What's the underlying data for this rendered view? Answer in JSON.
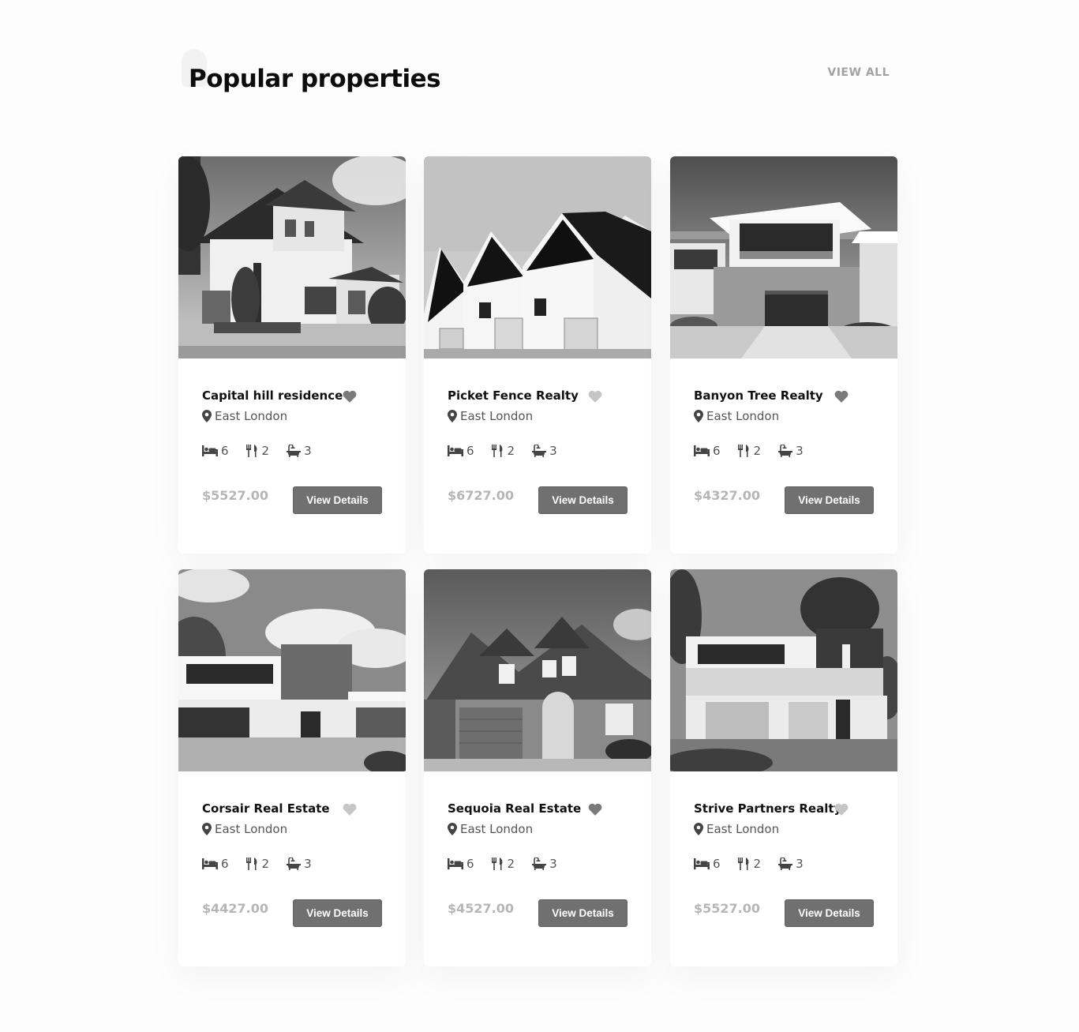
{
  "section": {
    "title": "Popular properties",
    "view_all_label": "VIEW ALL"
  },
  "colors": {
    "background": "#fdfdfd",
    "button": "#707070",
    "price": "#b6b6b6",
    "heart_dark": "#7a7a7a",
    "heart_light": "#c6c6c6"
  },
  "icons": {
    "location": "map-pin-icon",
    "bedrooms": "bed-icon",
    "dining": "fork-knife-icon",
    "bathrooms": "bathtub-icon",
    "favorite": "heart-icon"
  },
  "properties": [
    {
      "title": "Capital hill residence",
      "location": "East London",
      "bedrooms": "6",
      "dining": "2",
      "bathrooms": "3",
      "price": "$5527.00",
      "button_label": "View Details",
      "favorited": true
    },
    {
      "title": "Picket Fence Realty",
      "location": "East London",
      "bedrooms": "6",
      "dining": "2",
      "bathrooms": "3",
      "price": "$6727.00",
      "button_label": "View Details",
      "favorited": false
    },
    {
      "title": "Banyon Tree Realty",
      "location": "East London",
      "bedrooms": "6",
      "dining": "2",
      "bathrooms": "3",
      "price": "$4327.00",
      "button_label": "View Details",
      "favorited": true
    },
    {
      "title": "Corsair Real Estate",
      "location": "East London",
      "bedrooms": "6",
      "dining": "2",
      "bathrooms": "3",
      "price": "$4427.00",
      "button_label": "View Details",
      "favorited": false
    },
    {
      "title": "Sequoia Real Estate",
      "location": "East London",
      "bedrooms": "6",
      "dining": "2",
      "bathrooms": "3",
      "price": "$4527.00",
      "button_label": "View Details",
      "favorited": true
    },
    {
      "title": "Strive Partners Realty",
      "location": "East London",
      "bedrooms": "6",
      "dining": "2",
      "bathrooms": "3",
      "price": "$5527.00",
      "button_label": "View Details",
      "favorited": false
    }
  ]
}
